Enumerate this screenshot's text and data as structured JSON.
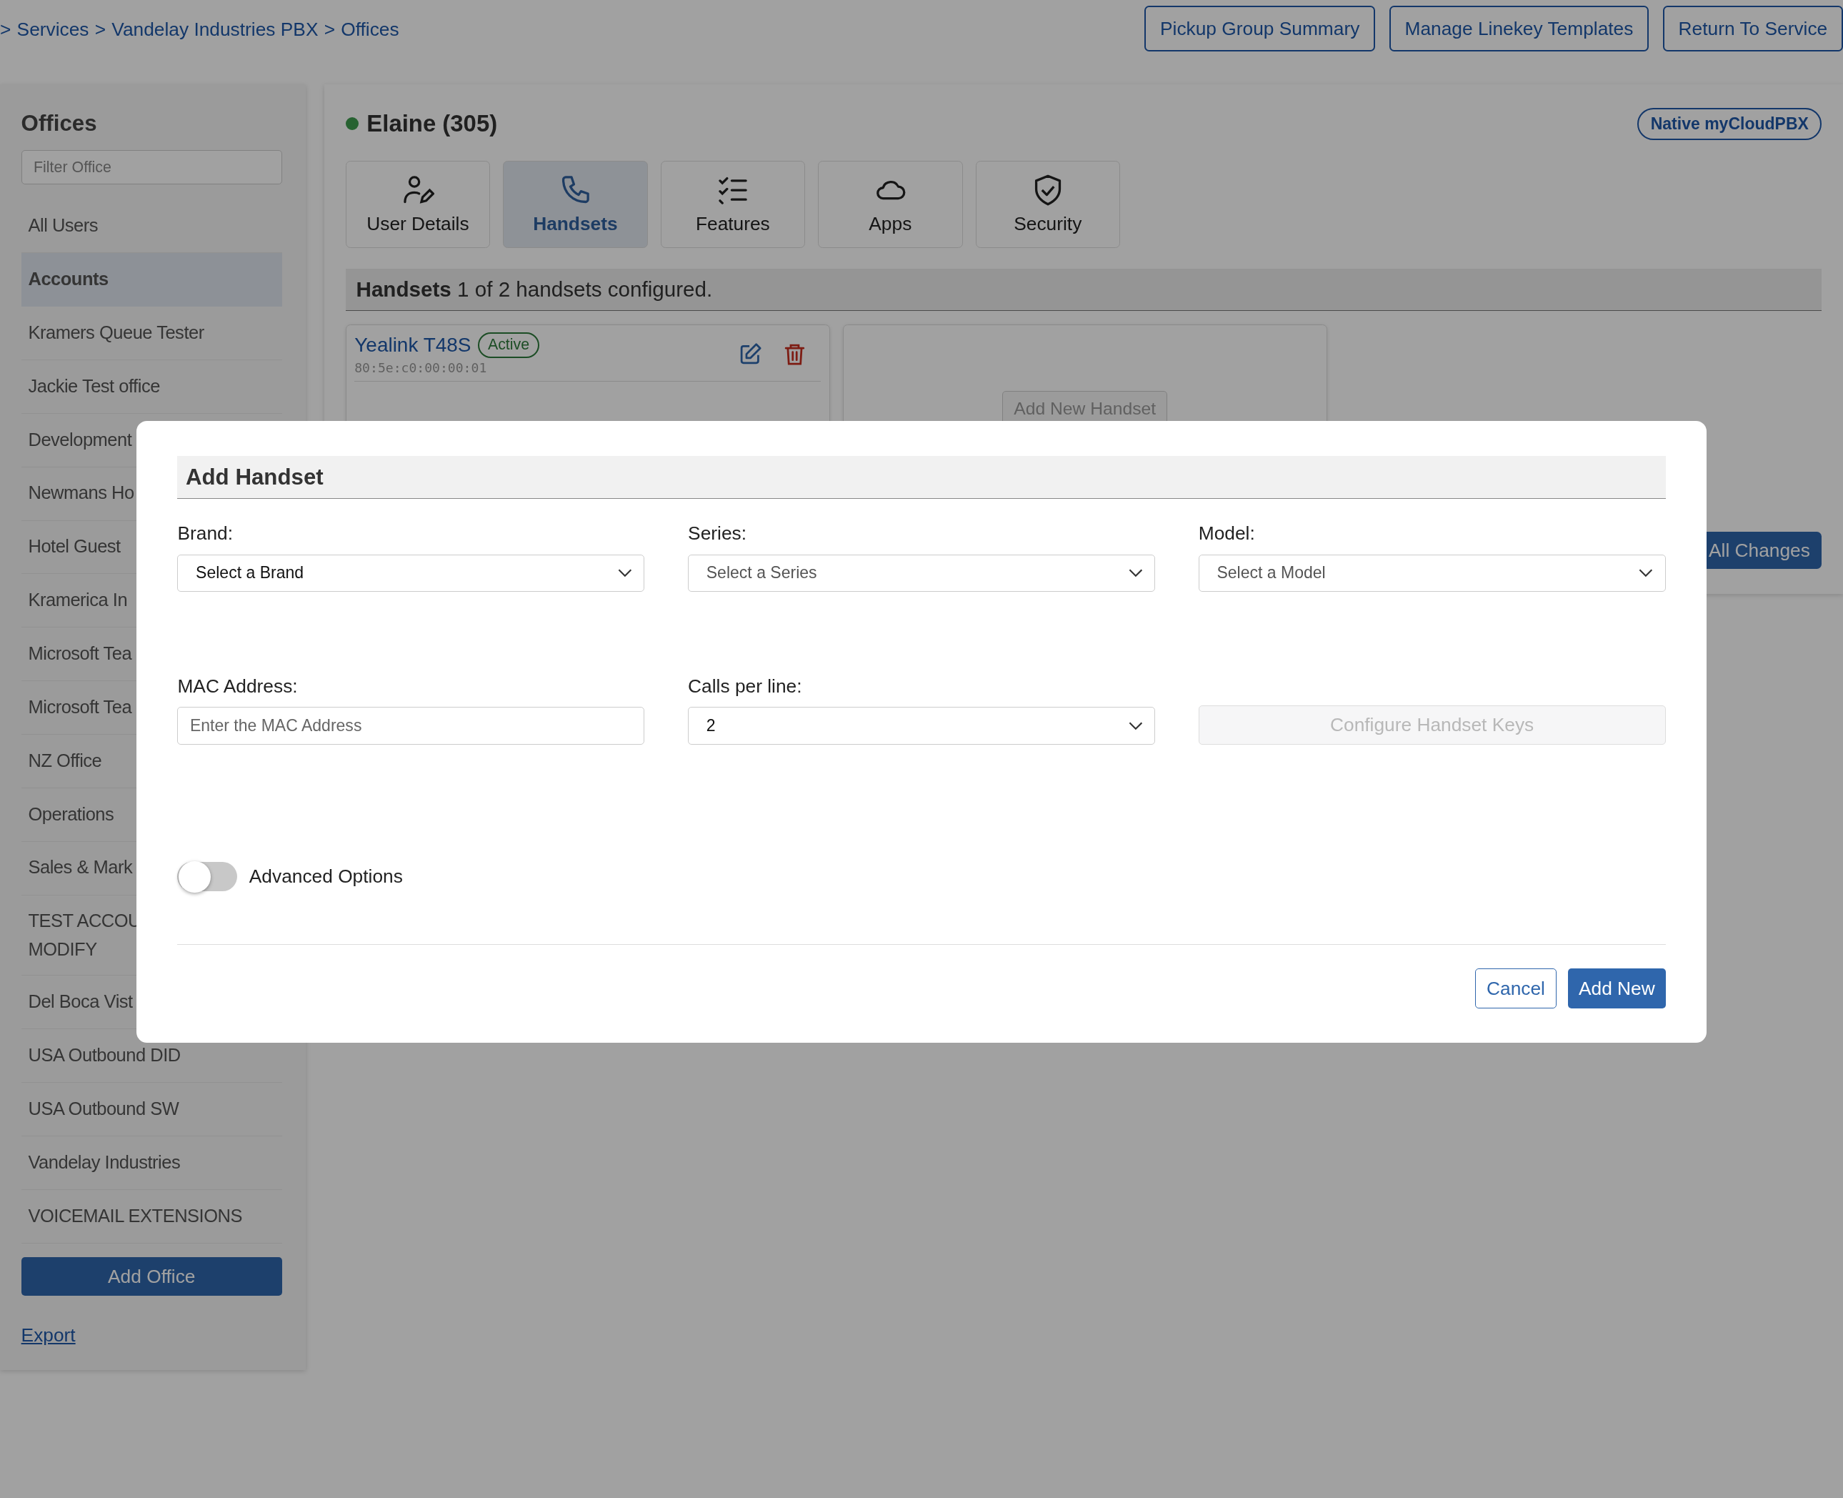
{
  "breadcrumb": {
    "separator": ">",
    "items": [
      "Services",
      "Vandelay Industries PBX",
      "Offices"
    ]
  },
  "header_buttons": [
    "Pickup Group Summary",
    "Manage Linekey Templates",
    "Return To Service"
  ],
  "sidebar": {
    "title": "Offices",
    "filter_placeholder": "Filter Office",
    "items": [
      {
        "lines": [
          "All Users"
        ],
        "selected": false
      },
      {
        "lines": [
          "Accounts"
        ],
        "selected": true
      },
      {
        "lines": [
          "Kramers Queue Tester"
        ],
        "selected": false
      },
      {
        "lines": [
          "Jackie Test office"
        ],
        "selected": false
      },
      {
        "lines": [
          "Development"
        ],
        "selected": false
      },
      {
        "lines": [
          "Newmans Ho"
        ],
        "selected": false
      },
      {
        "lines": [
          "Hotel Guest"
        ],
        "selected": false
      },
      {
        "lines": [
          "Kramerica In"
        ],
        "selected": false
      },
      {
        "lines": [
          "Microsoft Tea"
        ],
        "selected": false
      },
      {
        "lines": [
          "Microsoft Tea"
        ],
        "selected": false
      },
      {
        "lines": [
          "NZ Office"
        ],
        "selected": false
      },
      {
        "lines": [
          "Operations"
        ],
        "selected": false
      },
      {
        "lines": [
          "Sales & Mark"
        ],
        "selected": false
      },
      {
        "lines": [
          "TEST ACCOU",
          "MODIFY"
        ],
        "selected": false
      },
      {
        "lines": [
          "Del Boca Vist"
        ],
        "selected": false
      },
      {
        "lines": [
          "USA Outbound DID"
        ],
        "selected": false
      },
      {
        "lines": [
          "USA Outbound SW"
        ],
        "selected": false
      },
      {
        "lines": [
          "Vandelay Industries"
        ],
        "selected": false
      },
      {
        "lines": [
          "VOICEMAIL EXTENSIONS"
        ],
        "selected": false
      }
    ],
    "add_button": "Add Office",
    "export_link": "Export"
  },
  "user": {
    "name": "Elaine (305)",
    "online": true,
    "badge": "Native myCloudPBX"
  },
  "tabs": [
    {
      "label": "User Details",
      "selected": false
    },
    {
      "label": "Handsets",
      "selected": true
    },
    {
      "label": "Features",
      "selected": false
    },
    {
      "label": "Apps",
      "selected": false
    },
    {
      "label": "Security",
      "selected": false
    }
  ],
  "handsets_section": {
    "title": "Handsets",
    "summary": "1 of 2 handsets configured."
  },
  "handsets": [
    {
      "model": "Yealink T48S",
      "status": "Active",
      "mac": "80:5e:c0:00:00:01"
    }
  ],
  "add_handset_button": "Add New Handset",
  "save_button": "All Changes",
  "modal": {
    "title": "Add Handset",
    "fields": [
      {
        "kind": "select",
        "label": "Brand:",
        "placeholder": "Select a Brand",
        "disabled": false
      },
      {
        "kind": "select",
        "label": "Series:",
        "placeholder": "Select a Series",
        "disabled": true
      },
      {
        "kind": "select",
        "label": "Model:",
        "placeholder": "Select a Model",
        "disabled": true
      },
      {
        "kind": "input",
        "label": "MAC Address:",
        "placeholder": "Enter the MAC Address"
      },
      {
        "kind": "select",
        "label": "Calls per line:",
        "value": "2"
      },
      {
        "kind": "button",
        "label": "Configure Handset Keys",
        "disabled": true
      }
    ],
    "advanced_options": {
      "label": "Advanced Options",
      "on": false
    },
    "cancel_button": "Cancel",
    "add_button": "Add New"
  }
}
